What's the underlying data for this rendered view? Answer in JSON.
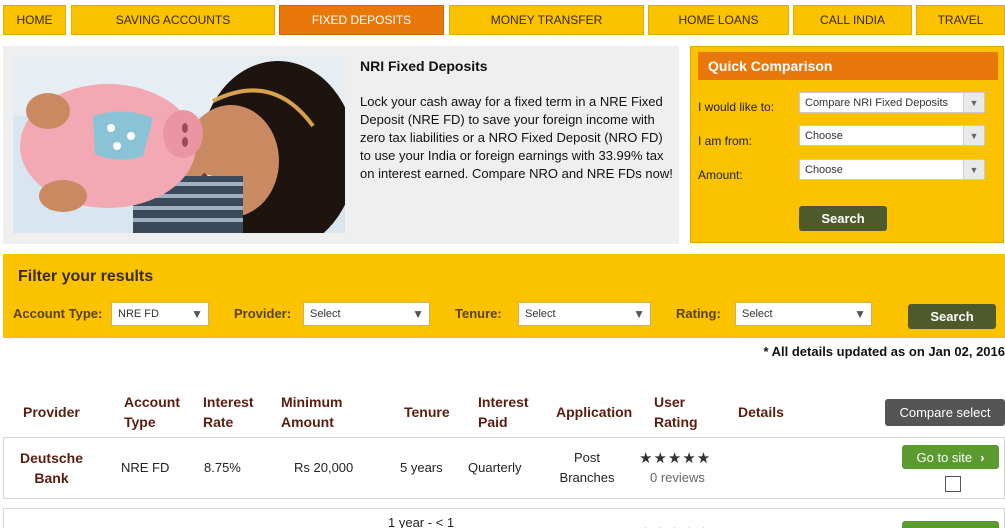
{
  "nav": {
    "tabs": [
      {
        "label": "HOME"
      },
      {
        "label": "SAVING ACCOUNTS"
      },
      {
        "label": "FIXED DEPOSITS"
      },
      {
        "label": "MONEY TRANSFER"
      },
      {
        "label": "HOME LOANS"
      },
      {
        "label": "CALL INDIA"
      },
      {
        "label": "TRAVEL"
      }
    ],
    "active_tab": "FIXED DEPOSITS"
  },
  "hero": {
    "title": "NRI Fixed Deposits",
    "text": "Lock your cash away for a fixed term in a NRE Fixed Deposit (NRE FD) to save your foreign income with zero tax liabilities or a NRO Fixed Deposit (NRO FD) to use your India or foreign earnings with 33.99% tax on interest earned. Compare NRO and NRE FDs now!"
  },
  "quick_comparison": {
    "title": "Quick Comparison",
    "would_like_label": "I would like to:",
    "would_like_value": "Compare NRI Fixed Deposits",
    "from_label": "I am from:",
    "from_value": "Choose",
    "amount_label": "Amount:",
    "amount_value": "Choose",
    "search_label": "Search"
  },
  "filter": {
    "title": "Filter your results",
    "account_type_label": "Account Type:",
    "account_type_value": "NRE FD",
    "provider_label": "Provider:",
    "provider_value": "Select",
    "tenure_label": "Tenure:",
    "tenure_value": "Select",
    "rating_label": "Rating:",
    "rating_value": "Select",
    "search_label": "Search"
  },
  "updated_note": "* All details updated as on Jan 02, 2016",
  "table": {
    "headers": {
      "provider": "Provider",
      "account_type_1": "Account",
      "account_type_2": "Type",
      "interest_rate_1": "Interest",
      "interest_rate_2": "Rate",
      "minimum_amount_1": "Minimum",
      "minimum_amount_2": "Amount",
      "tenure": "Tenure",
      "interest_paid_1": "Interest",
      "interest_paid_2": "Paid",
      "application": "Application",
      "user_rating_1": "User",
      "user_rating_2": "Rating",
      "details": "Details"
    },
    "compare_label": "Compare select",
    "rows": [
      {
        "provider_1": "Deutsche",
        "provider_2": "Bank",
        "account_type": "NRE FD",
        "interest_rate": "8.75%",
        "minimum_amount": "Rs 20,000",
        "tenure": "5 years",
        "interest_paid": "Quarterly",
        "application_1": "Post",
        "application_2": "Branches",
        "stars": "★★★★★",
        "reviews": "0 reviews",
        "goto_label": "Go to site"
      },
      {
        "tenure": "1 year - < 1",
        "stars": "★★★★★"
      }
    ]
  },
  "icons": {
    "dropdown": "chevron-down-icon",
    "goto": "chevron-right-icon",
    "star": "star-icon"
  },
  "colors": {
    "nav_bg": "#fbc200",
    "nav_active": "#e9780b",
    "search_button": "#4f5a2c",
    "goto_button": "#5b9a2f",
    "header_text": "#5a1e10"
  }
}
